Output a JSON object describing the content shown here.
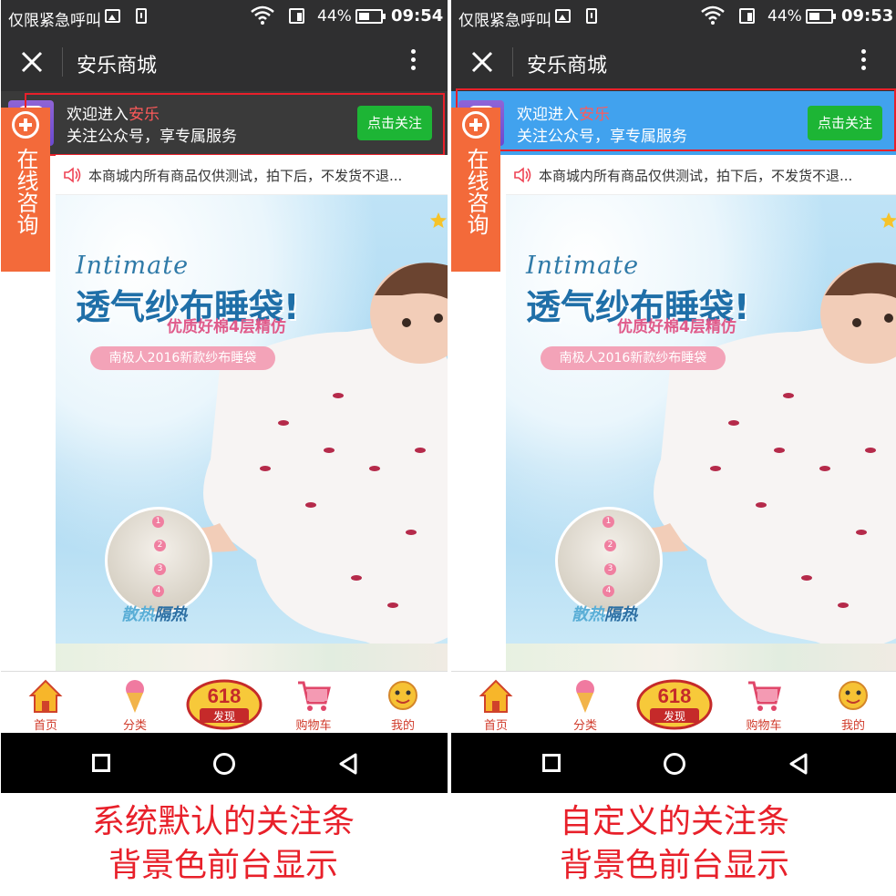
{
  "phones": [
    {
      "status": {
        "carrier": "仅限紧急呼叫",
        "battery": "44%",
        "time": "09:54"
      },
      "appbar": {
        "title": "安乐商城"
      },
      "follow": {
        "welcome_prefix": "欢迎进入",
        "welcome_name": "安乐",
        "subtitle": "关注公众号，享专属服务",
        "button": "点击关注",
        "background": "#3a3a3a"
      },
      "caption": [
        "系统默认的关注条",
        "背景色前台显示"
      ]
    },
    {
      "status": {
        "carrier": "仅限紧急呼叫",
        "battery": "44%",
        "time": "09:53"
      },
      "appbar": {
        "title": "安乐商城"
      },
      "follow": {
        "welcome_prefix": "欢迎进入",
        "welcome_name": "安乐",
        "subtitle": "关注公众号，享专属服务",
        "button": "点击关注",
        "background": "#41a2ee"
      },
      "caption": [
        "自定义的关注条",
        "背景色前台显示"
      ]
    }
  ],
  "consult": {
    "text": "在线咨询"
  },
  "notice": {
    "text": "本商城内所有商品仅供测试，拍下后，不发货不退..."
  },
  "banner": {
    "intimate": "Intimate",
    "headline": "透气纱布睡袋!",
    "sub": "优质好棉4层精仿",
    "pill": "南极人2016新款纱布睡袋",
    "layers": [
      "1",
      "2",
      "3",
      "4"
    ],
    "heat_light": "散热",
    "heat_bold": "隔热"
  },
  "tabs": [
    {
      "label": "首页",
      "icon": "house-icon"
    },
    {
      "label": "分类",
      "icon": "ice-cream-icon"
    },
    {
      "label": "618",
      "sublabel": "发现",
      "icon": "618-badge-icon"
    },
    {
      "label": "购物车",
      "icon": "cart-icon"
    },
    {
      "label": "我的",
      "icon": "face-icon"
    }
  ],
  "colors": {
    "highlight": "#e8202a",
    "follow_button": "#1db535",
    "consult": "#f36a3a",
    "default_bar": "#3a3a3a",
    "custom_bar": "#41a2ee"
  }
}
